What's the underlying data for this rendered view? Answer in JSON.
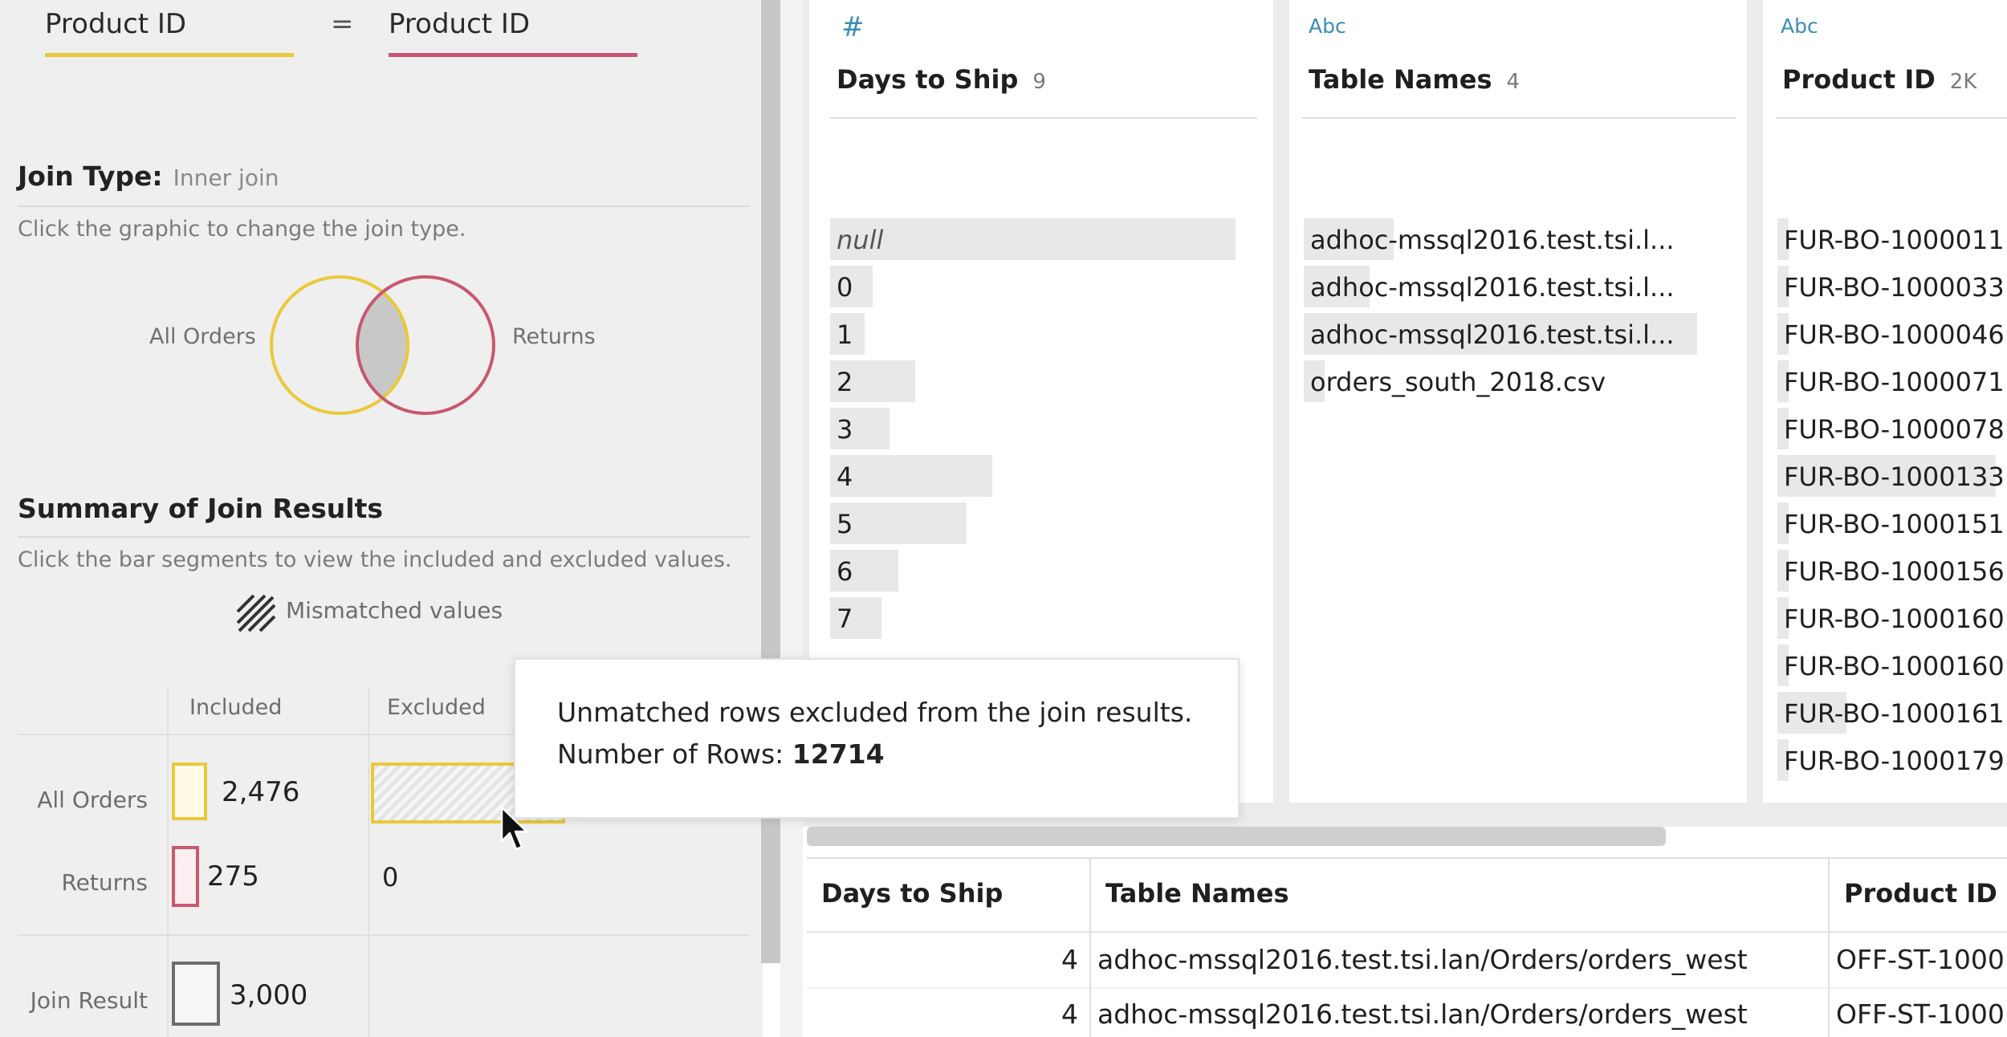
{
  "join_clause": {
    "left_field": "Product ID",
    "operator": "=",
    "right_field": "Product ID",
    "left_color": "#e8c93a",
    "right_color": "#c9576f"
  },
  "join_type": {
    "title": "Join Type:",
    "value": "Inner join",
    "hint": "Click the graphic to change the join type.",
    "left_label": "All Orders",
    "right_label": "Returns"
  },
  "summary": {
    "title": "Summary of Join Results",
    "hint": "Click the bar segments to view the included and excluded values.",
    "mismatched_label": "Mismatched values",
    "headers": {
      "included": "Included",
      "excluded": "Excluded"
    },
    "rows": [
      {
        "label": "All Orders",
        "included": "2,476",
        "excluded": ""
      },
      {
        "label": "Returns",
        "included": "275",
        "excluded": "0"
      }
    ],
    "join_result": {
      "label": "Join Result",
      "value": "3,000"
    }
  },
  "tooltip": {
    "line1": "Unmatched rows excluded from the join results.",
    "line2_label": "Number of Rows:",
    "line2_value": "12714"
  },
  "profile": {
    "columns": [
      {
        "type_icon": "#",
        "name": "Days to Ship",
        "count": "9",
        "values": [
          {
            "text": "null",
            "fill": 0.95
          },
          {
            "text": "0",
            "fill": 0.1
          },
          {
            "text": "1",
            "fill": 0.08
          },
          {
            "text": "2",
            "fill": 0.2
          },
          {
            "text": "3",
            "fill": 0.14
          },
          {
            "text": "4",
            "fill": 0.38
          },
          {
            "text": "5",
            "fill": 0.32
          },
          {
            "text": "6",
            "fill": 0.16
          },
          {
            "text": "7",
            "fill": 0.12
          }
        ]
      },
      {
        "type_icon": "Abc",
        "name": "Table Names",
        "count": "4",
        "values": [
          {
            "text": "adhoc-mssql2016.test.tsi.l...",
            "fill": 0.22
          },
          {
            "text": "adhoc-mssql2016.test.tsi.l...",
            "fill": 0.16
          },
          {
            "text": "adhoc-mssql2016.test.tsi.l...",
            "fill": 0.96
          },
          {
            "text": "orders_south_2018.csv",
            "fill": 0.05
          }
        ]
      },
      {
        "type_icon": "Abc",
        "name": "Product ID",
        "count": "2K",
        "values": [
          {
            "text": "FUR-BO-1000011",
            "fill": 0.05
          },
          {
            "text": "FUR-BO-1000033",
            "fill": 0.05
          },
          {
            "text": "FUR-BO-1000046",
            "fill": 0.05
          },
          {
            "text": "FUR-BO-1000071",
            "fill": 0.05
          },
          {
            "text": "FUR-BO-1000078",
            "fill": 0.05
          },
          {
            "text": "FUR-BO-1000133",
            "fill": 0.95
          },
          {
            "text": "FUR-BO-1000151",
            "fill": 0.05
          },
          {
            "text": "FUR-BO-1000156",
            "fill": 0.05
          },
          {
            "text": "FUR-BO-1000160",
            "fill": 0.05
          },
          {
            "text": "FUR-BO-1000160",
            "fill": 0.05
          },
          {
            "text": "FUR-BO-1000161",
            "fill": 0.3
          },
          {
            "text": "FUR-BO-1000179",
            "fill": 0.05
          }
        ]
      }
    ]
  },
  "table": {
    "headers": [
      "Days to Ship",
      "Table Names",
      "Product ID"
    ],
    "rows": [
      [
        "4",
        "adhoc-mssql2016.test.tsi.lan/Orders/orders_west",
        "OFF-ST-1000"
      ],
      [
        "4",
        "adhoc-mssql2016.test.tsi.lan/Orders/orders_west",
        "OFF-ST-1000"
      ]
    ]
  }
}
